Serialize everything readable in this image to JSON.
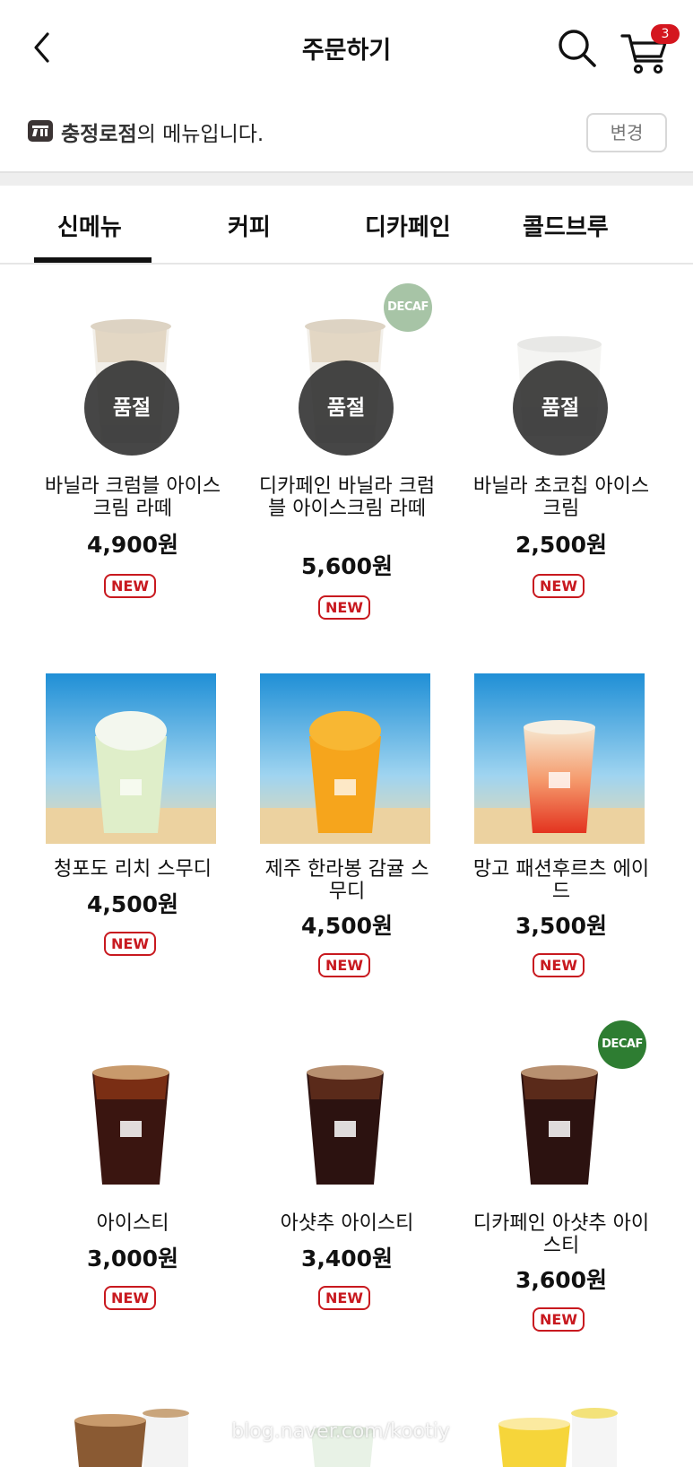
{
  "header": {
    "title": "주문하기",
    "cart_count": "3"
  },
  "store": {
    "name": "충정로점",
    "suffix": "의 메뉴입니다.",
    "change_label": "변경"
  },
  "tabs": [
    {
      "label": "신메뉴",
      "active": true
    },
    {
      "label": "커피",
      "active": false
    },
    {
      "label": "디카페인",
      "active": false
    },
    {
      "label": "콜드브루",
      "active": false
    }
  ],
  "products": [
    {
      "name": "바닐라 크럼블 아이스크림 라떼",
      "price": "4,900원",
      "badge": "NEW",
      "soldout_label": "품절",
      "decaf_label": "",
      "image": "latte-cup"
    },
    {
      "name": "디카페인 바닐라 크럼블 아이스크림 라떼",
      "price": "5,600원",
      "badge": "NEW",
      "soldout_label": "품절",
      "decaf_label": "DECAF",
      "image": "latte-cup"
    },
    {
      "name": "바닐라 초코칩 아이스크림",
      "price": "2,500원",
      "badge": "NEW",
      "soldout_label": "품절",
      "decaf_label": "",
      "image": "icecream-cup"
    },
    {
      "name": "청포도 리치 스무디",
      "price": "4,500원",
      "badge": "NEW",
      "soldout_label": "",
      "decaf_label": "",
      "image": "green-smoothie-beach"
    },
    {
      "name": "제주 한라봉 감귤 스무디",
      "price": "4,500원",
      "badge": "NEW",
      "soldout_label": "",
      "decaf_label": "",
      "image": "orange-smoothie-beach"
    },
    {
      "name": "망고 패션후르츠 에이드",
      "price": "3,500원",
      "badge": "NEW",
      "soldout_label": "",
      "decaf_label": "",
      "image": "red-ade-beach"
    },
    {
      "name": "아이스티",
      "price": "3,000원",
      "badge": "NEW",
      "soldout_label": "",
      "decaf_label": "",
      "image": "iced-tea-cup"
    },
    {
      "name": "아샷추 아이스티",
      "price": "3,400원",
      "badge": "NEW",
      "soldout_label": "",
      "decaf_label": "",
      "image": "iced-tea-cup"
    },
    {
      "name": "디카페인 아샷추 아이스티",
      "price": "3,600원",
      "badge": "NEW",
      "soldout_label": "",
      "decaf_label": "DECAF",
      "image": "iced-tea-cup"
    }
  ],
  "decaf_colors": [
    "#a7c4a6",
    "#2e7d32"
  ],
  "accent_color": "#c8191f",
  "watermark": "blog.naver.com/kootiy"
}
